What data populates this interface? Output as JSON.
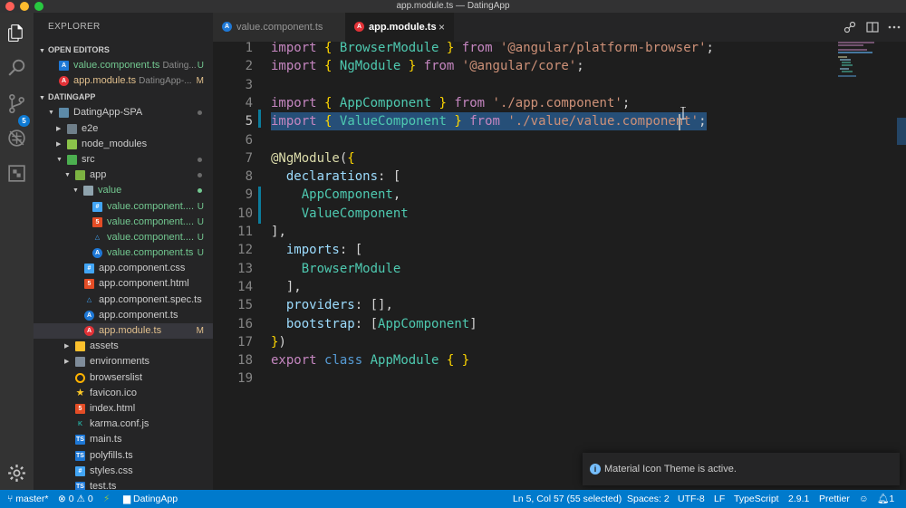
{
  "window": {
    "title": "app.module.ts — DatingApp"
  },
  "activity_bar": {
    "items": [
      "files-icon",
      "search-icon",
      "source-control-icon",
      "debug-icon",
      "extensions-icon"
    ],
    "scm_badge": "5",
    "settings_icon": "gear-icon"
  },
  "sidebar": {
    "title": "EXPLORER",
    "open_editors_label": "OPEN EDITORS",
    "open_editors": [
      {
        "name": "value.component.ts",
        "desc": "Dating...",
        "status": "U"
      },
      {
        "name": "app.module.ts",
        "desc": "DatingApp-...",
        "status": "M"
      }
    ],
    "project_label": "DATINGAPP",
    "tree": [
      {
        "name": "DatingApp-SPA",
        "status": ""
      },
      {
        "name": "e2e",
        "status": ""
      },
      {
        "name": "node_modules",
        "status": ""
      },
      {
        "name": "src",
        "status": ""
      },
      {
        "name": "app",
        "status": ""
      },
      {
        "name": "value",
        "status": ""
      },
      {
        "name": "value.component....",
        "status": "U"
      },
      {
        "name": "value.component....",
        "status": "U"
      },
      {
        "name": "value.component....",
        "status": "U"
      },
      {
        "name": "value.component.ts",
        "status": "U"
      },
      {
        "name": "app.component.css",
        "status": ""
      },
      {
        "name": "app.component.html",
        "status": ""
      },
      {
        "name": "app.component.spec.ts",
        "status": ""
      },
      {
        "name": "app.component.ts",
        "status": ""
      },
      {
        "name": "app.module.ts",
        "status": "M"
      },
      {
        "name": "assets",
        "status": ""
      },
      {
        "name": "environments",
        "status": ""
      },
      {
        "name": "browserslist",
        "status": ""
      },
      {
        "name": "favicon.ico",
        "status": ""
      },
      {
        "name": "index.html",
        "status": ""
      },
      {
        "name": "karma.conf.js",
        "status": ""
      },
      {
        "name": "main.ts",
        "status": ""
      },
      {
        "name": "polyfills.ts",
        "status": ""
      },
      {
        "name": "styles.css",
        "status": ""
      },
      {
        "name": "test.ts",
        "status": ""
      }
    ]
  },
  "tabs": [
    {
      "label": "value.component.ts",
      "active": false
    },
    {
      "label": "app.module.ts",
      "active": true
    }
  ],
  "tab_close": "×",
  "editor": {
    "active_line": 5,
    "lines": [
      "import { BrowserModule } from '@angular/platform-browser';",
      "import { NgModule } from '@angular/core';",
      "",
      "import { AppComponent } from './app.component';",
      "import { ValueComponent } from './value/value.component';",
      "",
      "@NgModule({",
      "  declarations: [",
      "    AppComponent,",
      "    ValueComponent",
      "],",
      "  imports: [",
      "    BrowserModule",
      "  ],",
      "  providers: [],",
      "  bootstrap: [AppComponent]",
      "})",
      "export class AppModule { }",
      ""
    ]
  },
  "notification": {
    "text": "Material Icon Theme is active."
  },
  "status_bar": {
    "branch": "master*",
    "errors": "0",
    "warnings": "0",
    "folder": "DatingApp",
    "position": "Ln 5, Col 57 (55 selected)",
    "spaces": "Spaces: 2",
    "encoding": "UTF-8",
    "eol": "LF",
    "language": "TypeScript",
    "version": "2.9.1",
    "formatter": "Prettier",
    "notifications": "1"
  },
  "colors": {
    "status_bar": "#007acc",
    "untracked": "#73c991",
    "modified": "#e2c08d",
    "selection": "#264f78"
  }
}
